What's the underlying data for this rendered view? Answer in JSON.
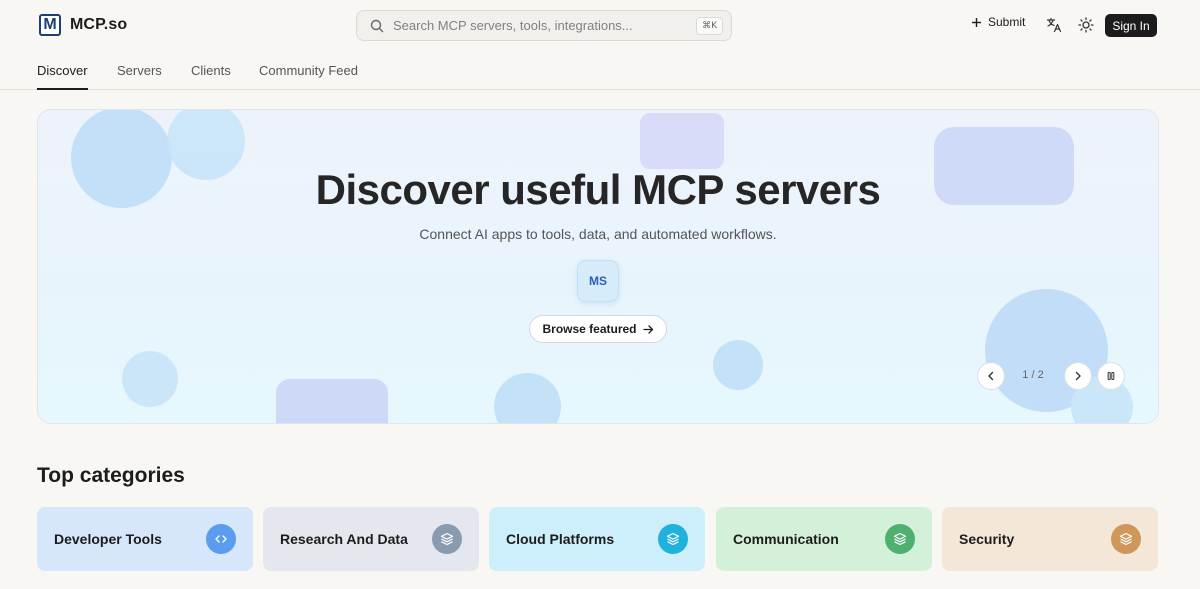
{
  "header": {
    "logo_text": "MCP.so",
    "logo_mark": "M",
    "search_placeholder": "Search MCP servers, tools, integrations...",
    "search_shortcut": "⌘K",
    "submit_label": "Submit",
    "signin_label": "Sign In"
  },
  "tabs": [
    {
      "label": "Discover",
      "active": true
    },
    {
      "label": "Servers",
      "active": false
    },
    {
      "label": "Clients",
      "active": false
    },
    {
      "label": "Community Feed",
      "active": false
    }
  ],
  "hero": {
    "title": "Discover useful MCP servers",
    "subtitle": "Connect AI apps to tools, data, and automated workflows.",
    "chip": "MS",
    "cta_label": "Browse featured",
    "pager": "1 / 2"
  },
  "categories": {
    "heading": "Top categories",
    "items": [
      {
        "label": "Developer Tools",
        "icon": "code-icon",
        "bg": "#d6e6fb",
        "icon_bg": "#5b9cf0"
      },
      {
        "label": "Research And Data",
        "icon": "layers-icon",
        "bg": "#e4e8ee",
        "icon_bg": "#8a9bb0"
      },
      {
        "label": "Cloud Platforms",
        "icon": "layers-icon",
        "bg": "#cdeefb",
        "icon_bg": "#1eb2dc"
      },
      {
        "label": "Communication",
        "icon": "layers-icon",
        "bg": "#d3f1d9",
        "icon_bg": "#4fb070"
      },
      {
        "label": "Security",
        "icon": "layers-icon",
        "bg": "#f5e7d8",
        "icon_bg": "#d0975a"
      }
    ]
  },
  "colors": {
    "background": "#f8f7f4",
    "accent_dark": "#1c1c1c",
    "logo_blue": "#1d3f74"
  }
}
